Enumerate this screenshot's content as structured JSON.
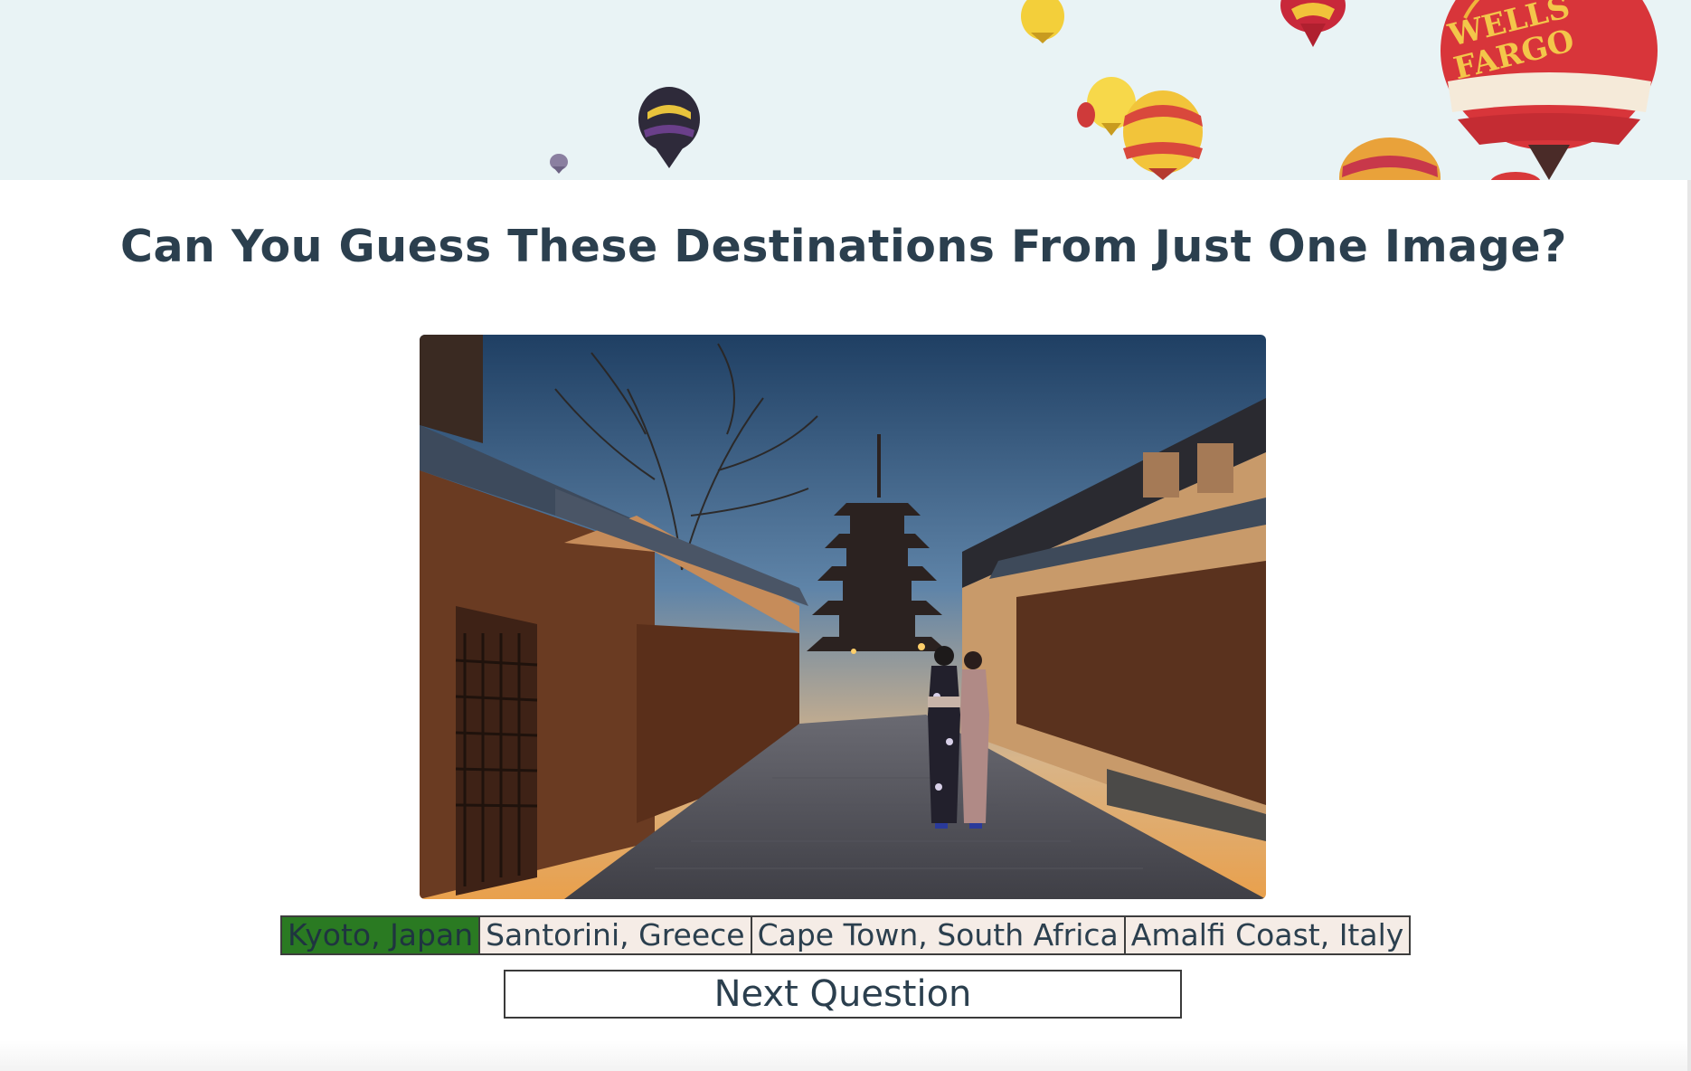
{
  "page": {
    "title": "Can You Guess These Destinations From Just One Image?"
  },
  "banner": {
    "balloon_brand_text_line1": "WELLS",
    "balloon_brand_text_line2": "FARGO"
  },
  "quiz": {
    "options": [
      {
        "label": "Kyoto, Japan",
        "state": "correct"
      },
      {
        "label": "Santorini, Greece",
        "state": "default"
      },
      {
        "label": "Cape Town, South Africa",
        "state": "default"
      },
      {
        "label": "Amalfi Coast, Italy",
        "state": "default"
      }
    ],
    "next_label": "Next Question"
  },
  "colors": {
    "banner_bg": "#e9f3f5",
    "title_text": "#2b3f4e",
    "option_bg": "#f5ece6",
    "correct_bg": "#2a7a22",
    "border": "#3d3d3d"
  },
  "icons": {
    "banner": "hot-air-balloons-banner",
    "photo": "kyoto-street-pagoda-photo"
  }
}
